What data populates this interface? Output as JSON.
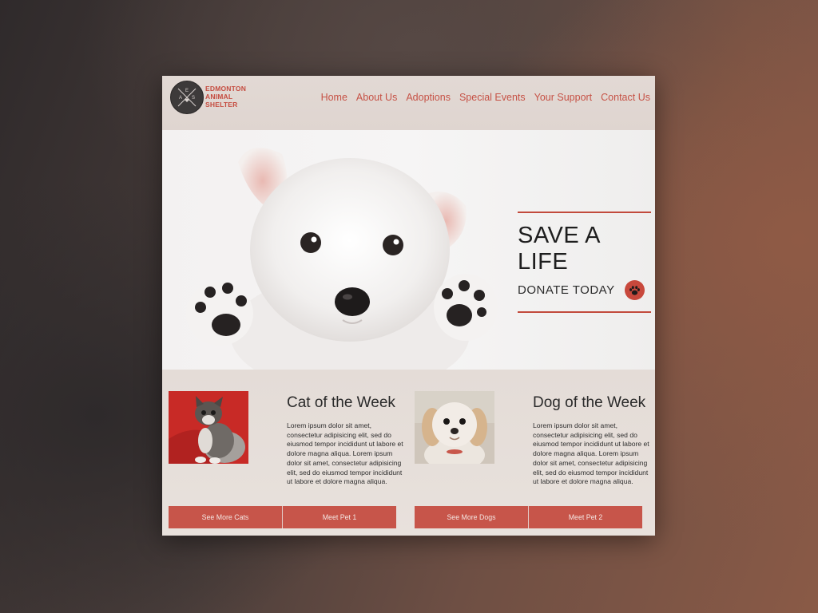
{
  "brand": {
    "line1": "EDMONTON",
    "line2": "ANIMAL",
    "line3": "SHELTER",
    "badge_letters": [
      "E",
      "A",
      "S"
    ],
    "accent_color": "#c54c40"
  },
  "nav": {
    "items": [
      "Home",
      "About Us",
      "Adoptions",
      "Special Events",
      "Your Support",
      "Contact Us"
    ]
  },
  "hero": {
    "headline": "SAVE A LIFE",
    "cta": "DONATE TODAY",
    "cta_icon": "paw-icon"
  },
  "cat_feature": {
    "title": "Cat of the Week",
    "body": "Lorem ipsum dolor sit amet, consectetur adipisicing elit, sed do eiusmod tempor incididunt ut labore et dolore magna aliqua. Lorem ipsum dolor sit amet, consectetur adipisicing elit, sed do eiusmod tempor incididunt ut labore et dolore magna aliqua.",
    "btn_more": "See More Cats",
    "btn_meet": "Meet Pet 1"
  },
  "dog_feature": {
    "title": "Dog of the Week",
    "body": "Lorem ipsum dolor sit amet, consectetur adipisicing elit, sed do eiusmod tempor incididunt ut labore et dolore magna aliqua. Lorem ipsum dolor sit amet, consectetur adipisicing elit, sed do eiusmod tempor incididunt ut labore et dolore magna aliqua.",
    "btn_more": "See More Dogs",
    "btn_meet": "Meet Pet 2"
  }
}
